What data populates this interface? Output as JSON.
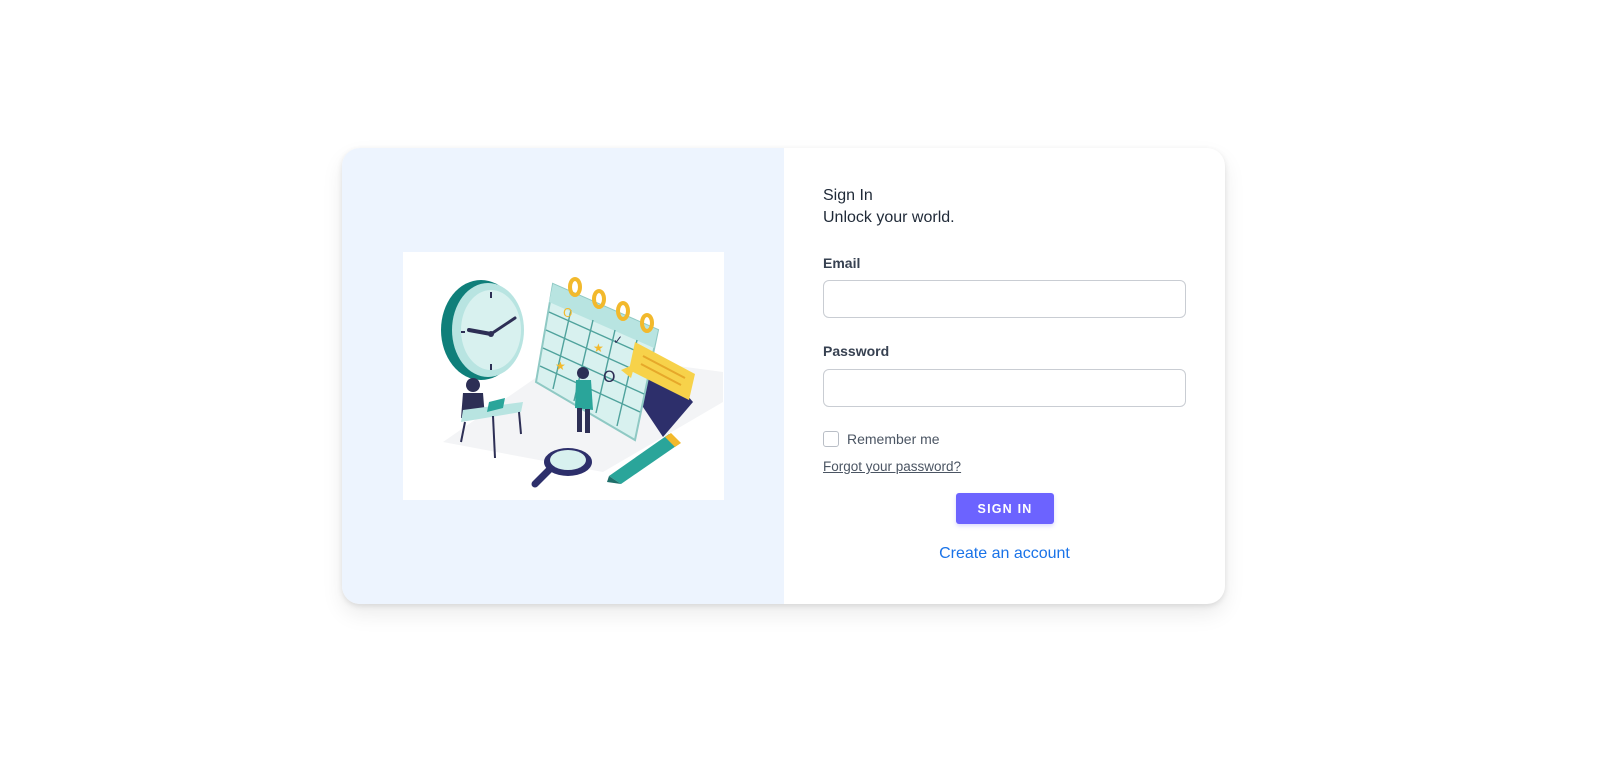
{
  "left_panel": {
    "illustration": "calendar-clock-scheduling-illustration"
  },
  "form": {
    "title": "Sign In",
    "subtitle": "Unlock your world.",
    "email_label": "Email",
    "email_value": "",
    "password_label": "Password",
    "password_value": "",
    "remember_label": "Remember me",
    "remember_checked": false,
    "forgot_link": "Forgot your password?",
    "signin_button": "SIGN IN",
    "create_account_link": "Create an account"
  },
  "colors": {
    "accent": "#6c63ff",
    "link": "#1a73e8",
    "left_panel_bg": "#edf4fe"
  }
}
